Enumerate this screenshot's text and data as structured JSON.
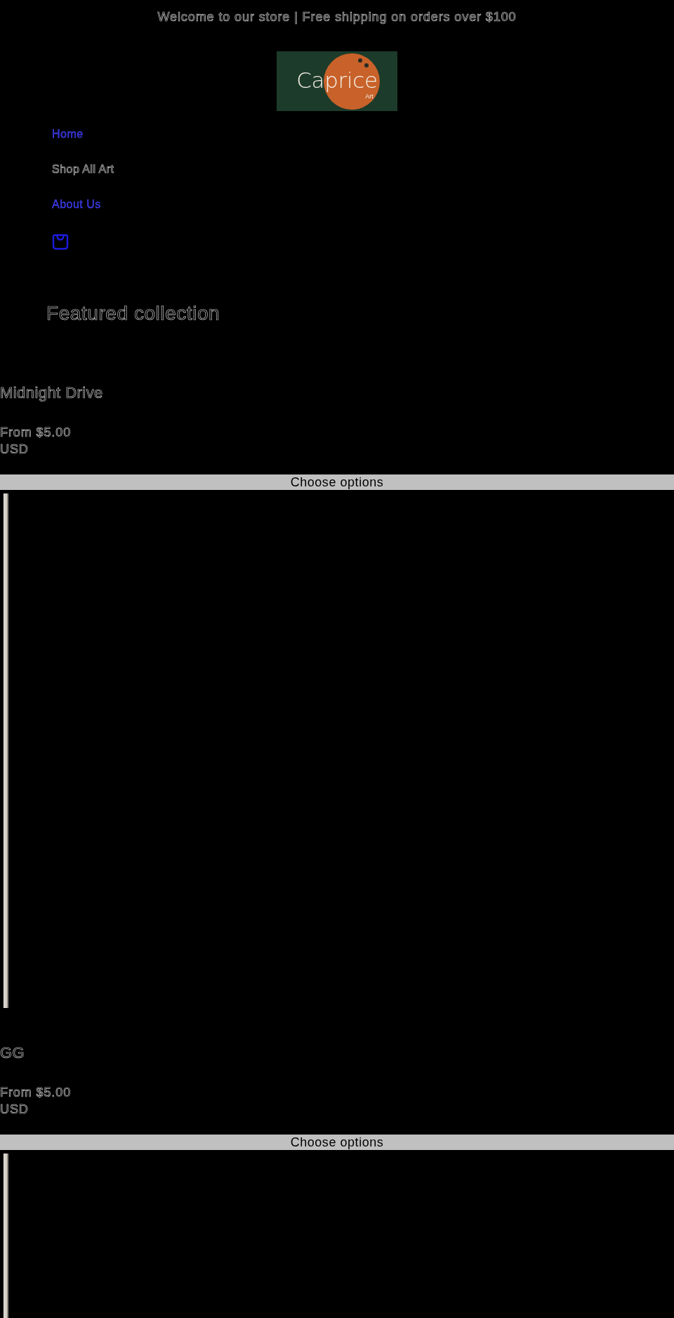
{
  "announcement": "Welcome to our store | Free shipping on orders over $100",
  "logo": {
    "name": "Caprice",
    "tagline": "Art"
  },
  "nav": [
    {
      "label": "Home",
      "selected": false
    },
    {
      "label": "Shop All Art",
      "selected": true
    },
    {
      "label": "About Us",
      "selected": false
    }
  ],
  "heading": "Featured collection",
  "products": [
    {
      "title": "Midnight Drive",
      "price": "From $5.00",
      "currency": "USD",
      "button": "Choose options"
    },
    {
      "title": "GG",
      "price": "From $5.00",
      "currency": "USD",
      "button": "Choose options"
    }
  ]
}
